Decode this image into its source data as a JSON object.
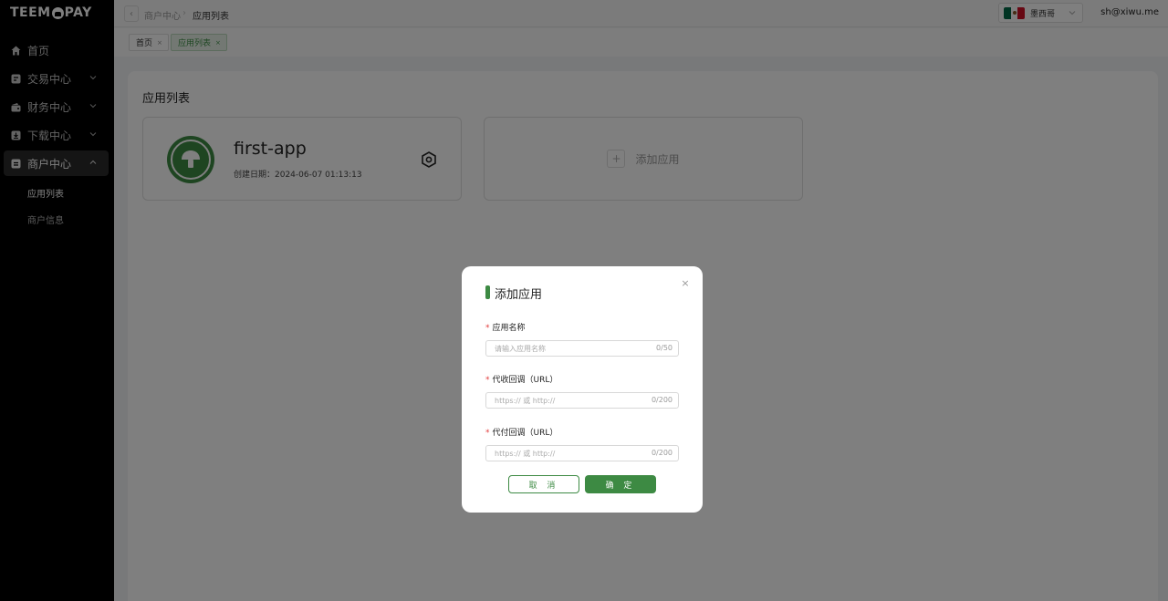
{
  "brand": {
    "logo_before": "TEEM",
    "logo_after": "PAY"
  },
  "sidebar": {
    "items": [
      {
        "label": "首页",
        "icon": "home-icon"
      },
      {
        "label": "交易中心",
        "icon": "transaction-icon"
      },
      {
        "label": "财务中心",
        "icon": "wallet-icon"
      },
      {
        "label": "下载中心",
        "icon": "download-icon"
      },
      {
        "label": "商户中心",
        "icon": "merchant-icon"
      }
    ],
    "sub_items": [
      {
        "label": "应用列表"
      },
      {
        "label": "商户信息"
      }
    ]
  },
  "topbar": {
    "back_label": "‹",
    "breadcrumb": [
      "商户中心",
      "应用列表"
    ],
    "breadcrumb_sep": "›",
    "language": "墨西哥",
    "flag_colors": [
      "#006847",
      "#ffffff",
      "#ce1126"
    ],
    "user_email": "sh@xiwu.me"
  },
  "tags": [
    {
      "label": "首页",
      "close": "×"
    },
    {
      "label": "应用列表",
      "close": "×"
    }
  ],
  "main": {
    "title": "应用列表",
    "app": {
      "name": "first-app",
      "created": "创建日期：2024-06-07 01:13:13"
    },
    "add": {
      "plus": "+",
      "label": "添加应用"
    }
  },
  "modal": {
    "title": "添加应用",
    "close": "×",
    "required_mark": "*",
    "fields": [
      {
        "label": "应用名称",
        "placeholder": "请输入应用名称",
        "count": "0/50"
      },
      {
        "label": "代收回调（URL）",
        "placeholder": "https:// 或 http://",
        "count": "0/200"
      },
      {
        "label": "代付回调（URL）",
        "placeholder": "https:// 或 http://",
        "count": "0/200"
      }
    ],
    "cancel": "取 消",
    "ok": "确 定"
  },
  "colors": {
    "accent": "#3d8a43",
    "sidebar_bg": "#000000",
    "required": "#e23c3c"
  }
}
